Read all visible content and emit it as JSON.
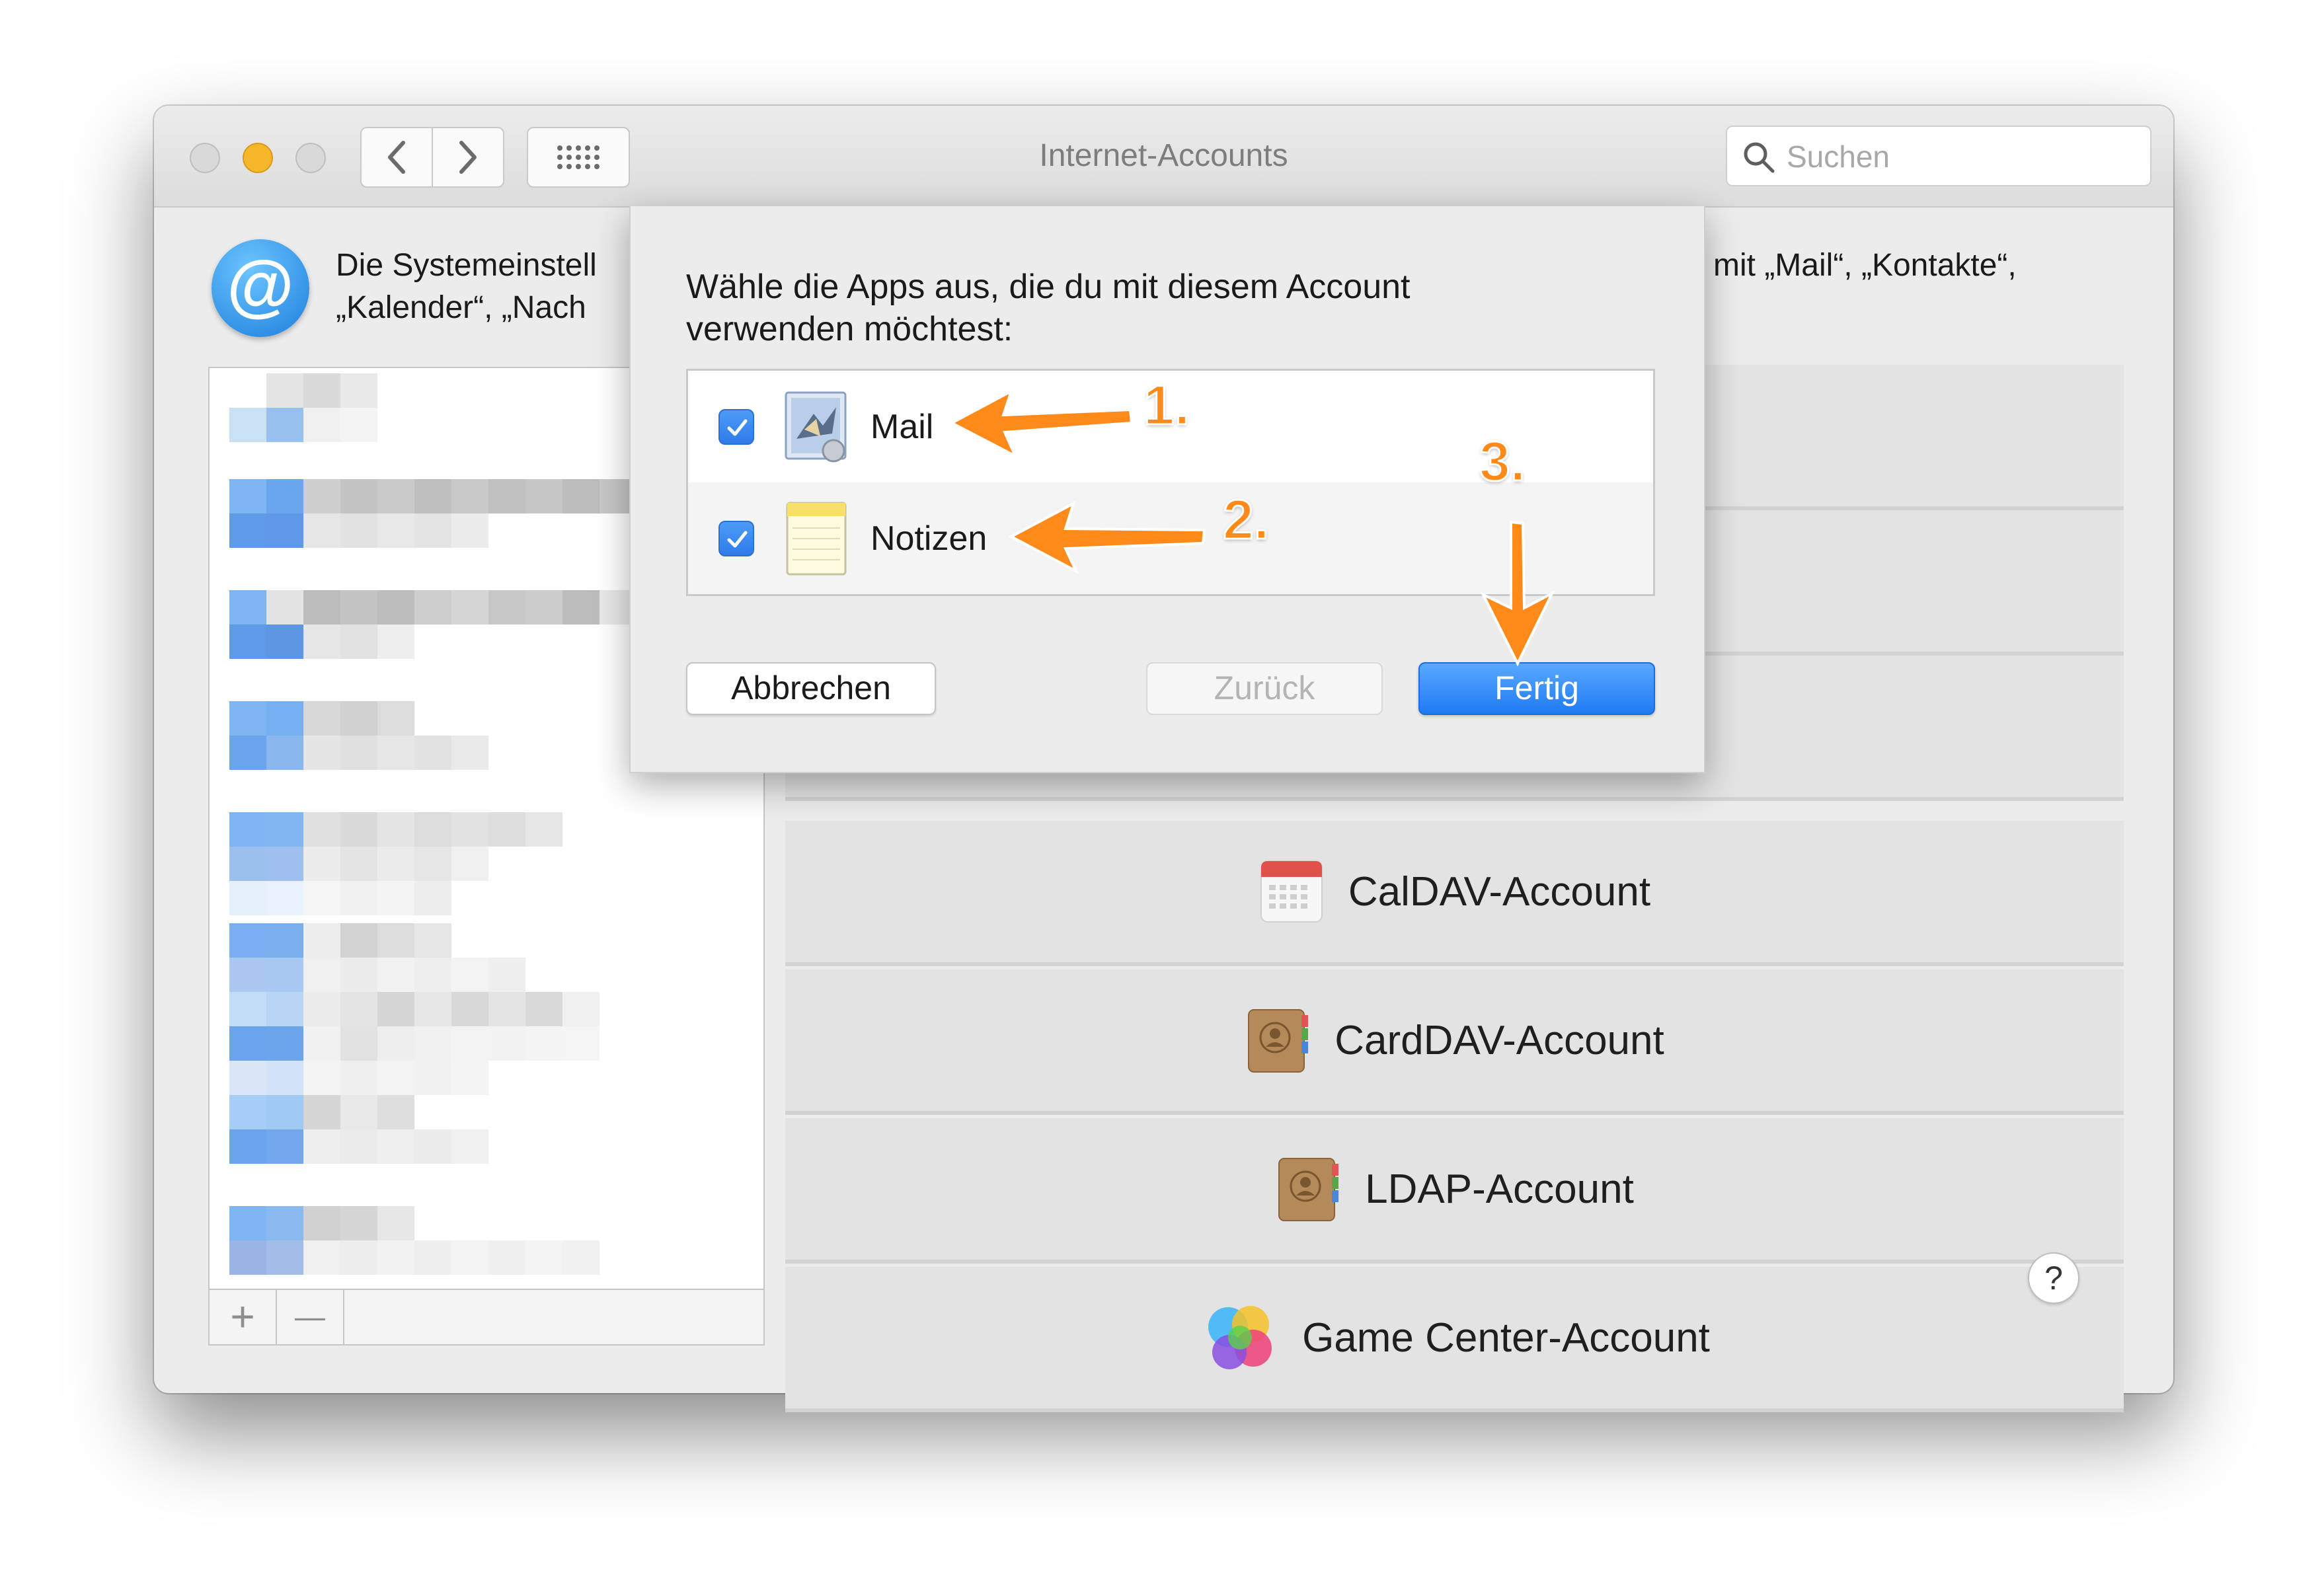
{
  "window": {
    "title": "Internet-Accounts",
    "search_placeholder": "Suchen"
  },
  "header": {
    "description_line1_left": "Die Systemeinstell",
    "description_line1_right": "mit „Mail“, „Kontakte“,",
    "description_line2_left": "„Kalender“, „Nach"
  },
  "sidebar": {
    "add_label": "+",
    "remove_label": "—"
  },
  "providers": [
    {
      "label": "CalDAV-Account",
      "icon": "calendar-icon"
    },
    {
      "label": "CardDAV-Account",
      "icon": "contacts-book-icon"
    },
    {
      "label": "LDAP-Account",
      "icon": "contacts-book-icon"
    },
    {
      "label": "Game Center-Account",
      "icon": "game-center-icon"
    }
  ],
  "help_label": "?",
  "sheet": {
    "prompt_line1": "Wähle die Apps aus, die du mit diesem Account",
    "prompt_line2": "verwenden möchtest:",
    "apps": [
      {
        "label": "Mail",
        "checked": true,
        "icon": "mail-app-icon"
      },
      {
        "label": "Notizen",
        "checked": true,
        "icon": "notes-app-icon"
      }
    ],
    "cancel_label": "Abbrechen",
    "back_label": "Zurück",
    "done_label": "Fertig"
  },
  "annotations": {
    "step1": "1.",
    "step2": "2.",
    "step3": "3."
  },
  "colors": {
    "accent_blue": "#2f7bea",
    "annotation_orange": "#ff8a1a"
  }
}
